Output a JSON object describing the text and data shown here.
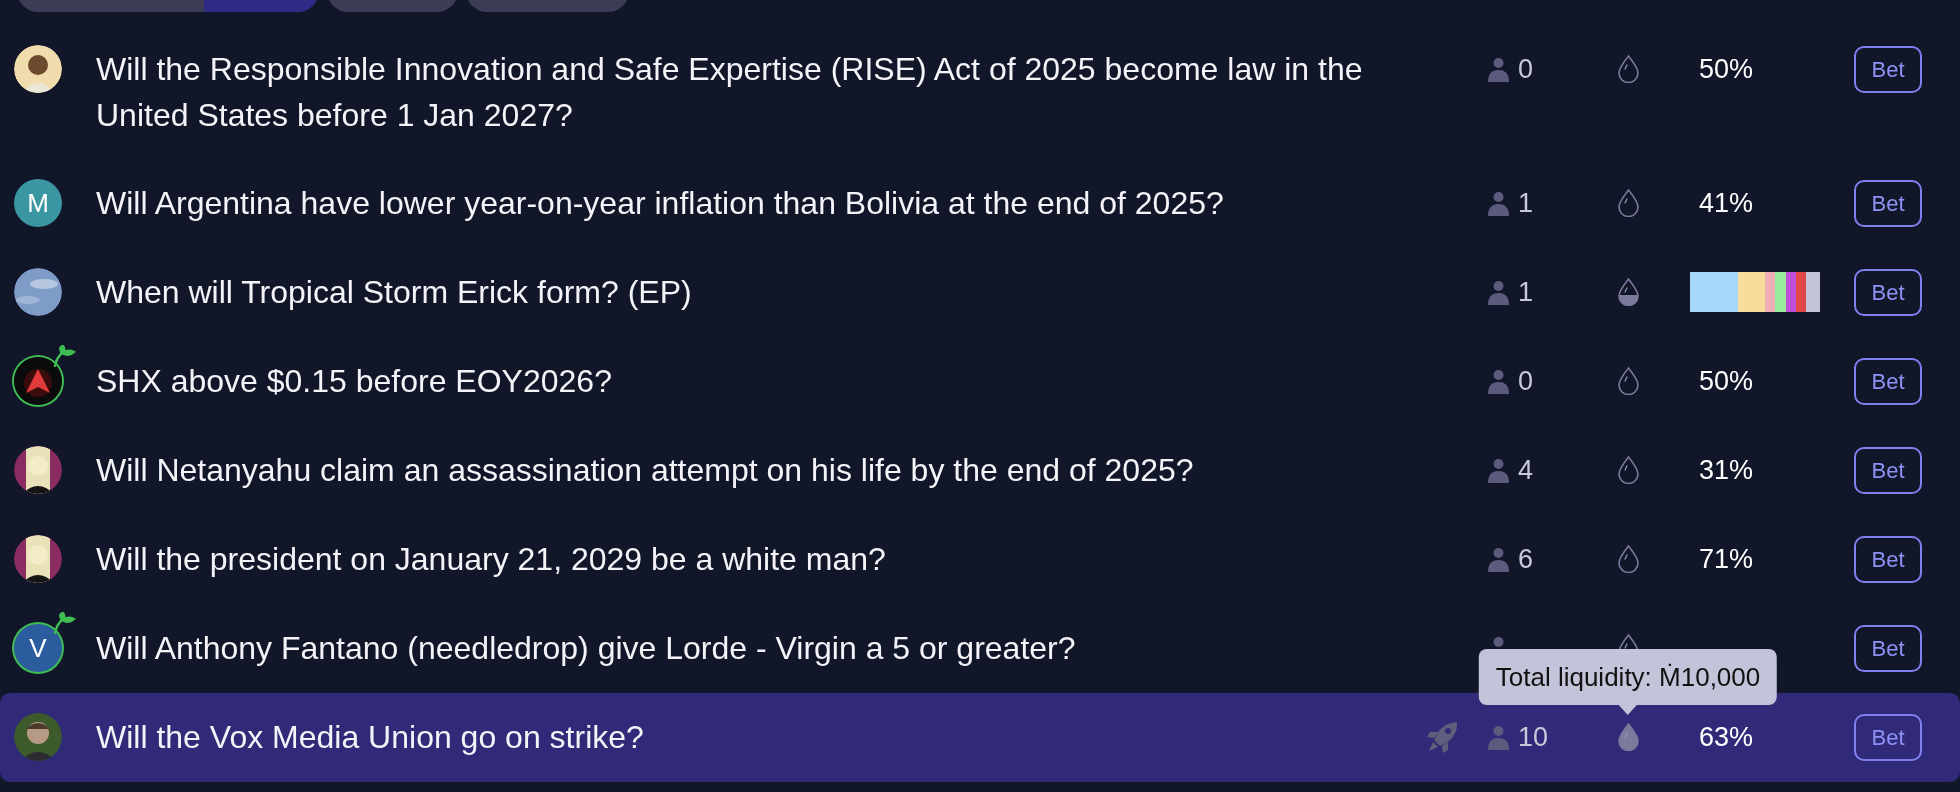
{
  "filter_pills": [
    {
      "selected": true
    },
    {
      "selected": false
    },
    {
      "selected": false
    }
  ],
  "markets": [
    {
      "new": false,
      "title": "Will the Responsible Innovation and Safe Expertise (RISE) Act of 2025 become law in the United States before 1 Jan 2027?",
      "boosted": false,
      "traders": "0",
      "liquidity": {
        "kind": "empty"
      },
      "probability": {
        "kind": "binary",
        "text": "50%"
      },
      "bet": "Bet",
      "selected": false
    },
    {
      "avatar": {
        "kind": "letter",
        "text": "M",
        "color": "#3a96a0"
      },
      "new": false,
      "title": "Will Argentina have lower year-on-year inflation than Bolivia at the end of 2025?",
      "boosted": false,
      "traders": "1",
      "liquidity": {
        "kind": "empty"
      },
      "probability": {
        "kind": "binary",
        "text": "41%"
      },
      "bet": "Bet",
      "selected": false
    },
    {
      "new": false,
      "title": "When will Tropical Storm Erick form? (EP)",
      "boosted": false,
      "traders": "1",
      "liquidity": {
        "kind": "partial"
      },
      "probability": {
        "kind": "multi",
        "segments": [
          {
            "color": "#a5d8f8"
          },
          {
            "color": "#f8dc9c"
          },
          {
            "color": "#f2aeb8"
          },
          {
            "color": "#98ec9c"
          },
          {
            "color": "#bf4fd6"
          },
          {
            "color": "#e04848"
          },
          {
            "color": "#c4c4d8"
          }
        ]
      },
      "bet": "Bet",
      "selected": false
    },
    {
      "new": true,
      "title": "SHX above $0.15 before EOY2026?",
      "boosted": false,
      "traders": "0",
      "liquidity": {
        "kind": "empty"
      },
      "probability": {
        "kind": "binary",
        "text": "50%"
      },
      "bet": "Bet",
      "selected": false
    },
    {
      "new": false,
      "title": "Will Netanyahu claim an assassination attempt on his life by the end of 2025?",
      "boosted": false,
      "traders": "4",
      "liquidity": {
        "kind": "empty"
      },
      "probability": {
        "kind": "binary",
        "text": "31%"
      },
      "bet": "Bet",
      "selected": false
    },
    {
      "new": false,
      "title": "Will the president on January 21, 2029 be a white man?",
      "boosted": false,
      "traders": "6",
      "liquidity": {
        "kind": "empty"
      },
      "probability": {
        "kind": "binary",
        "text": "71%"
      },
      "bet": "Bet",
      "selected": false
    },
    {
      "avatar": {
        "kind": "letter",
        "text": "V",
        "color": "#2a5c9e"
      },
      "new": true,
      "title": "Will Anthony Fantano (needledrop) give Lorde - Virgin a 5 or greater?",
      "boosted": false,
      "liquidity": {
        "kind": "empty"
      },
      "probability": {
        "kind": "binary"
      },
      "bet": "Bet",
      "selected": false
    },
    {
      "new": false,
      "title": "Will the Vox Media Union go on strike?",
      "boosted": true,
      "traders": "10",
      "liquidity": {
        "kind": "full",
        "tooltip": "Total liquidity: Ṁ10,000"
      },
      "probability": {
        "kind": "binary",
        "text": "63%"
      },
      "bet": "Bet",
      "selected": true
    }
  ]
}
